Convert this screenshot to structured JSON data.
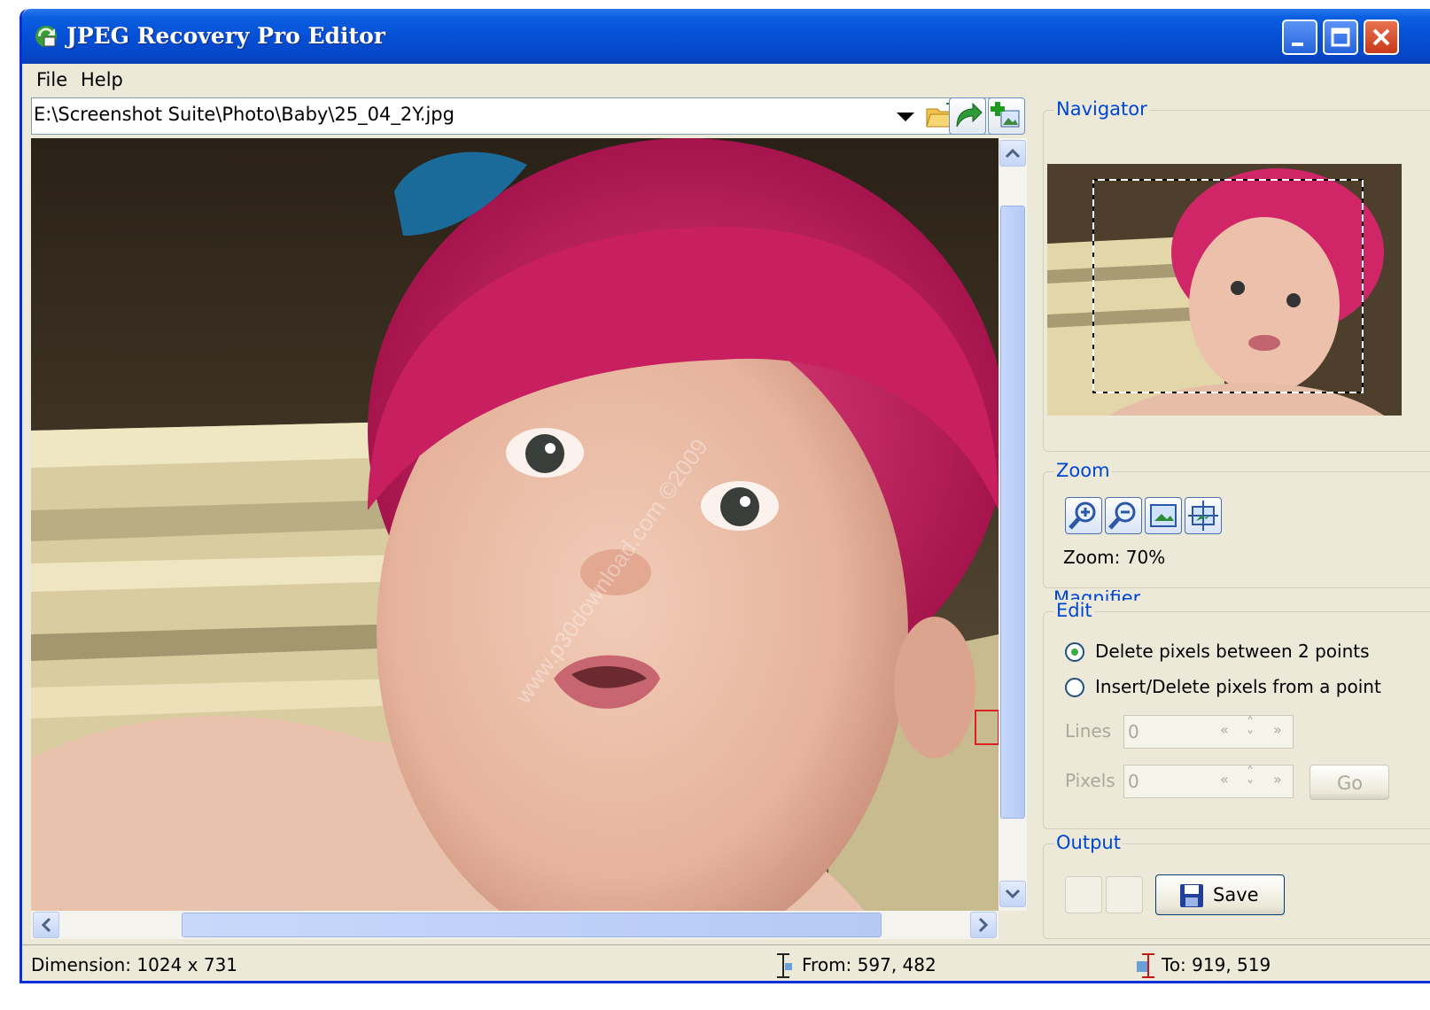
{
  "window": {
    "title": "JPEG Recovery Pro Editor"
  },
  "menu": {
    "file": "File",
    "help": "Help"
  },
  "toolbar": {
    "path": "E:\\Screenshot Suite\\Photo\\Baby\\25_04_2Y.jpg"
  },
  "panel": {
    "navigator": {
      "title": "Navigator"
    },
    "zoom": {
      "title": "Zoom",
      "level_text": "Zoom: 70%"
    },
    "magnifier": {
      "title": "Magnifier"
    },
    "edit": {
      "title": "Edit",
      "options": [
        {
          "label": "Delete pixels between 2 points",
          "checked": true
        },
        {
          "label": "Insert/Delete pixels from a point",
          "checked": false
        }
      ],
      "lines_label": "Lines",
      "lines_value": "0",
      "pixels_label": "Pixels",
      "pixels_value": "0",
      "go_label": "Go"
    },
    "output": {
      "title": "Output",
      "save_label": "Save"
    }
  },
  "status": {
    "dimension": "Dimension: 1024 x 731",
    "from": "From: 597, 482",
    "to": "To: 919, 519"
  },
  "watermark": "www.p30download.com  ©2009",
  "colors": {
    "title_blue": "#0650d6",
    "group_label": "#0046d5",
    "window_face": "#ece9d8",
    "close_red": "#c8391b"
  }
}
